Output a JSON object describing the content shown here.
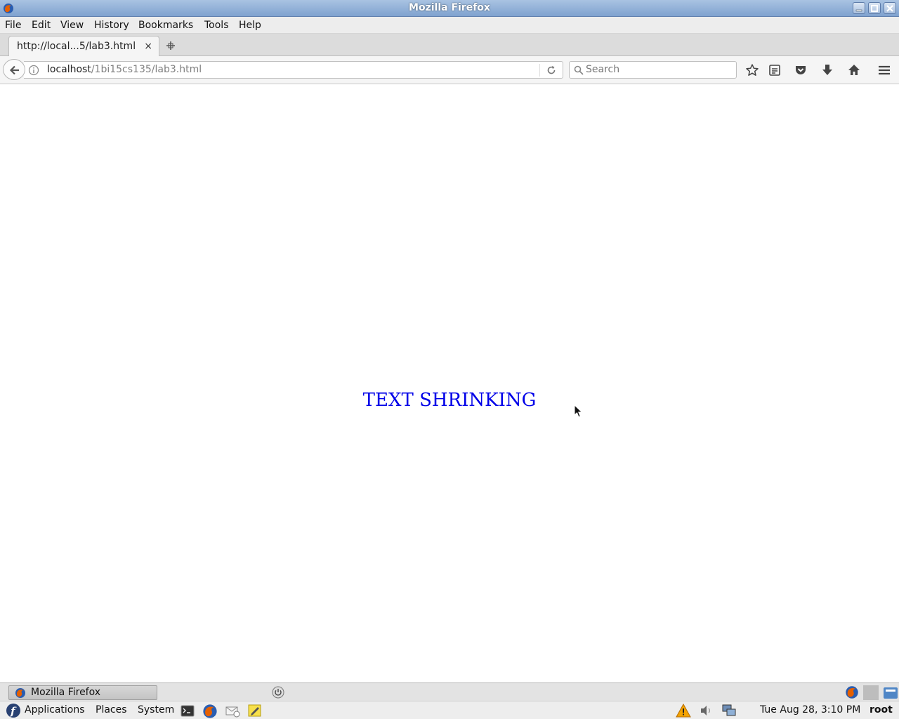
{
  "window": {
    "title": "Mozilla Firefox"
  },
  "menu": {
    "file": "File",
    "edit": "Edit",
    "view": "View",
    "history": "History",
    "bookmarks": "Bookmarks",
    "tools": "Tools",
    "help": "Help"
  },
  "tab": {
    "label": "http://local...5/lab3.html",
    "close": "×"
  },
  "url": {
    "host": "localhost",
    "path": "/1bi15cs135/lab3.html"
  },
  "search": {
    "placeholder": "Search"
  },
  "page": {
    "text": "TEXT SHRINKING",
    "text_color": "#0000e8"
  },
  "taskbar": {
    "window_label": "Mozilla Firefox"
  },
  "panel": {
    "applications": "Applications",
    "places": "Places",
    "system": "System",
    "clock": "Tue Aug 28,  3:10 PM",
    "user": "root"
  },
  "icons": [
    "firefox-icon",
    "minimize-icon",
    "maximize-icon",
    "close-icon",
    "new-tab-icon",
    "back-icon",
    "info-icon",
    "reload-icon",
    "search-icon",
    "bookmark-star-icon",
    "reading-list-icon",
    "pocket-icon",
    "download-icon",
    "home-icon",
    "hamburger-menu-icon",
    "power-icon",
    "fedora-icon",
    "terminal-icon",
    "mail-icon",
    "notes-icon",
    "warning-icon",
    "volume-icon",
    "network-icon",
    "files-icon"
  ]
}
